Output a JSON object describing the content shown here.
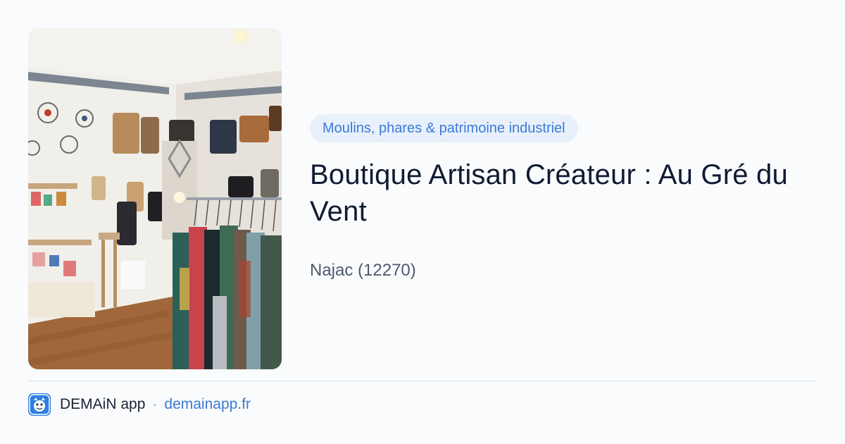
{
  "image": {
    "subject": "boutique-interior-photo"
  },
  "category": {
    "label": "Moulins, phares & patrimoine industriel"
  },
  "place": {
    "title": "Boutique Artisan Créateur : Au Gré du Vent",
    "location": "Najac (12270)"
  },
  "footer": {
    "app_icon": "demain-app-icon",
    "app_name": "DEMAiN app",
    "separator": "·",
    "domain": "demainapp.fr"
  },
  "colors": {
    "accent": "#3c7ad6",
    "chip_bg": "#e8f0fb",
    "title": "#0f1b33",
    "muted": "#4d5a6e",
    "background": "#fafbfc"
  }
}
